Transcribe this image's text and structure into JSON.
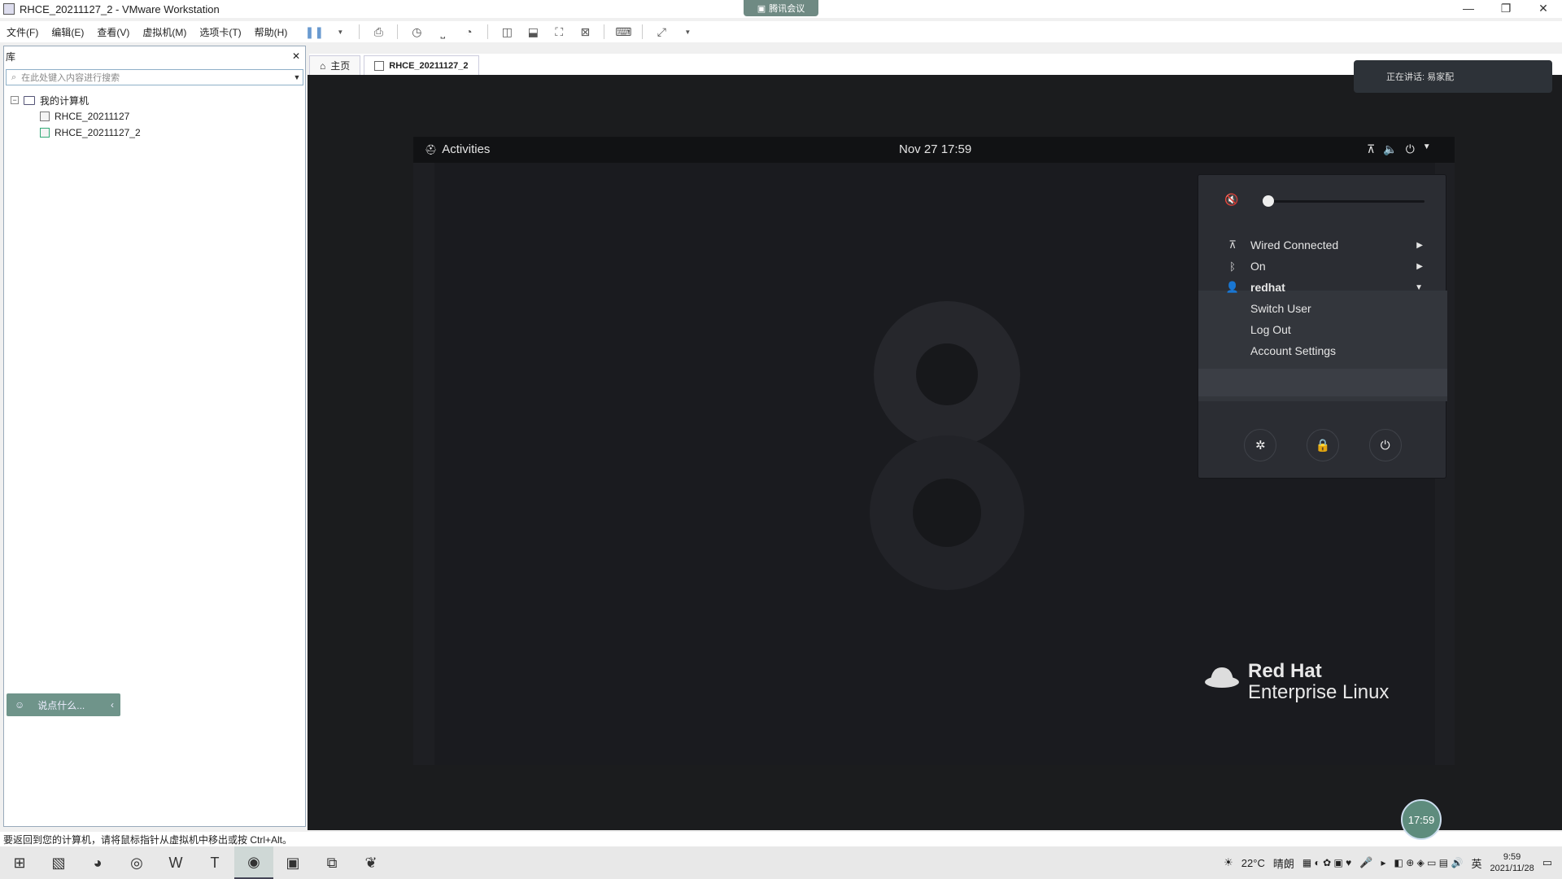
{
  "window": {
    "title": "RHCE_20211127_2 - VMware Workstation",
    "meeting_badge": "腾讯会议",
    "minimize": "—",
    "maximize": "❐",
    "close": "✕"
  },
  "menu": {
    "items": [
      "文件(F)",
      "编辑(E)",
      "查看(V)",
      "虚拟机(M)",
      "选项卡(T)",
      "帮助(H)"
    ]
  },
  "library": {
    "header": "库",
    "close": "✕",
    "search_placeholder": "在此处键入内容进行搜索",
    "root": "我的计算机",
    "vms": [
      "RHCE_20211127",
      "RHCE_20211127_2"
    ],
    "chat_placeholder": "说点什么..."
  },
  "tabs": [
    {
      "label": "主页"
    },
    {
      "label": "RHCE_20211127_2"
    }
  ],
  "stream_overlay": "正在讲话: 易家配",
  "guest": {
    "activities": "Activities",
    "clock": "Nov 27  17:59",
    "brand_line1": "Red Hat",
    "brand_line2": "Enterprise Linux",
    "popup": {
      "volume_level": 0.02,
      "network": "Wired Connected",
      "bluetooth": "On",
      "user": "redhat",
      "switch_user": "Switch User",
      "log_out": "Log Out",
      "account_settings": "Account Settings"
    }
  },
  "status_text": "要返回到您的计算机，请将鼠标指针从虚拟机中移出或按 Ctrl+Alt。",
  "clock_bubble": "17:59",
  "taskbar": {
    "weather": "22°C",
    "weather_desc": "晴朗",
    "ime": "英",
    "time": "9:59",
    "date": "2021/11/28"
  }
}
